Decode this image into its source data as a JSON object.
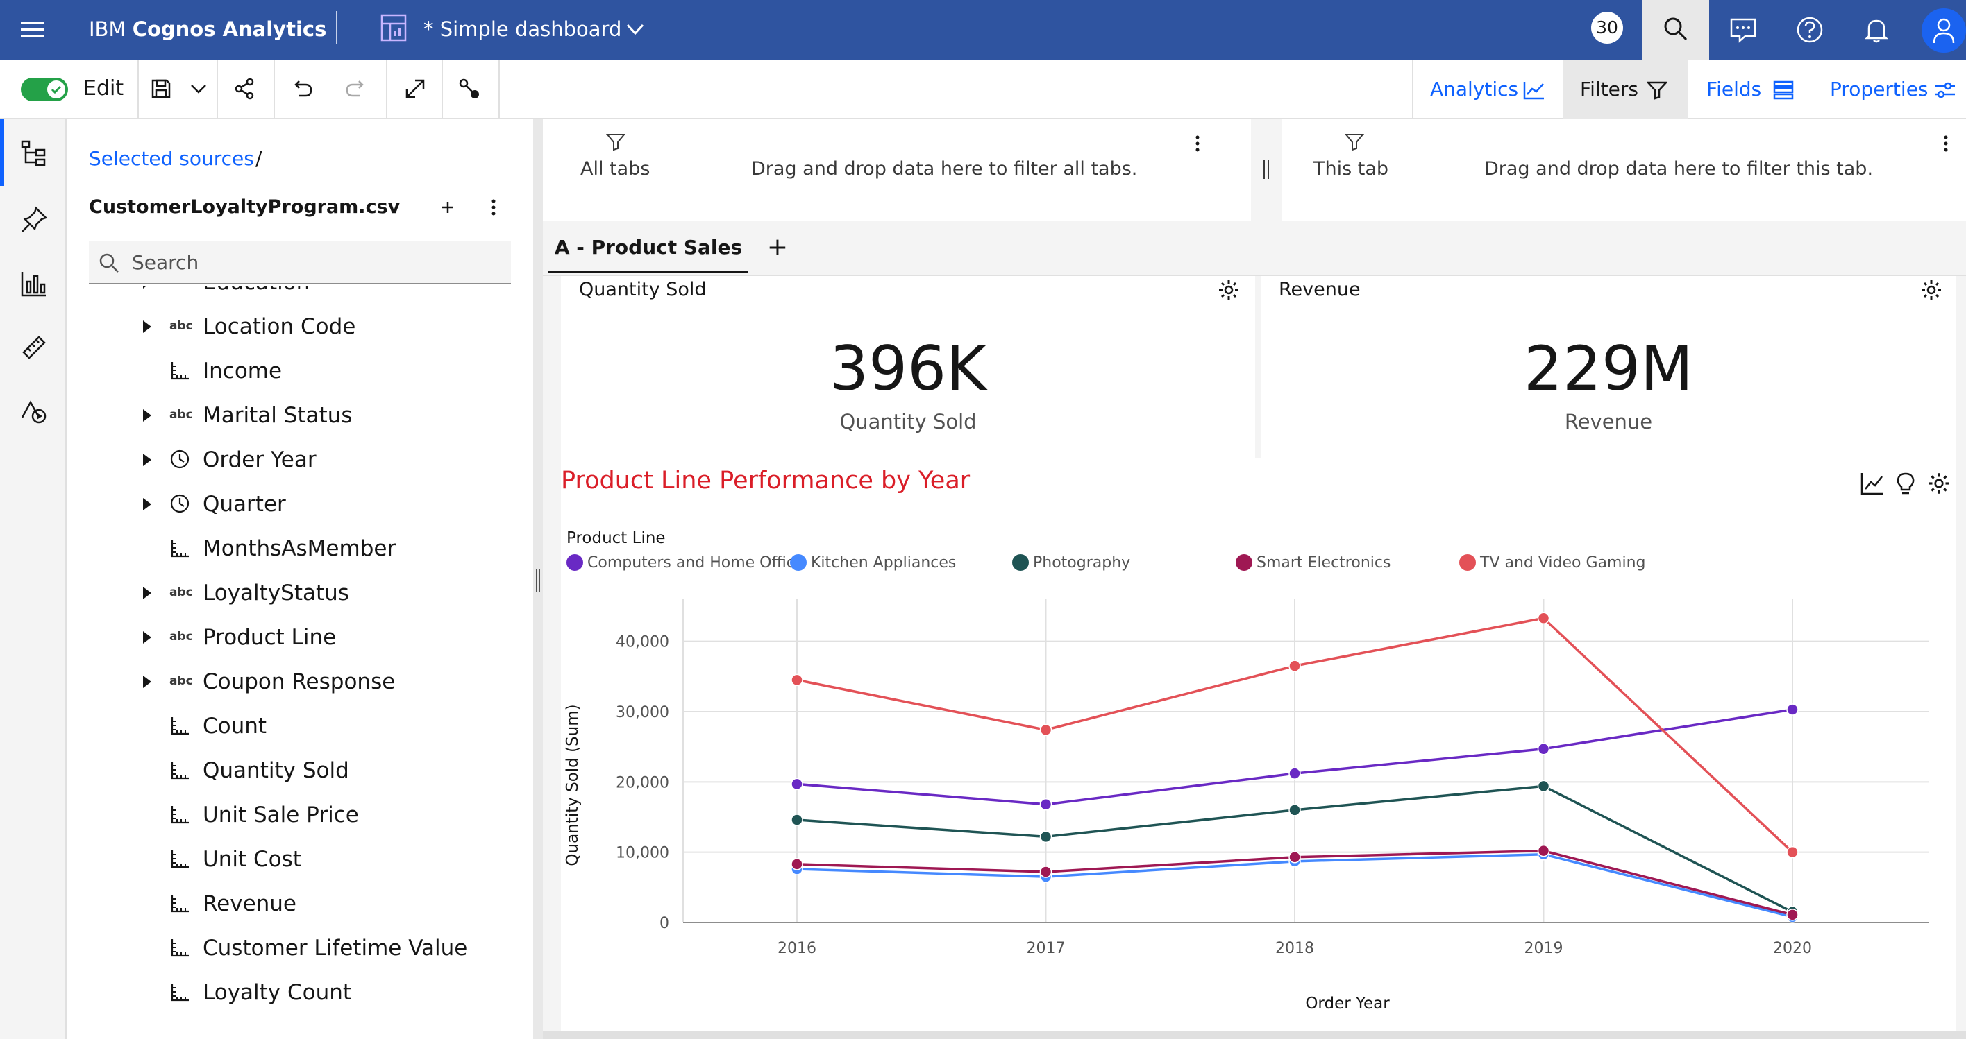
{
  "topbar": {
    "brand_prefix": "IBM ",
    "brand_name": "Cognos Analytics",
    "dashboard_title": "* Simple dashboard",
    "notification_count": "30"
  },
  "toolbar": {
    "edit_label": "Edit",
    "edit_mode_on": true,
    "tabs": [
      "Analytics",
      "Filters",
      "Fields",
      "Properties"
    ],
    "active_tab": "Filters"
  },
  "panel": {
    "breadcrumb": "Selected sources",
    "breadcrumb_sep": "/",
    "source_name": "CustomerLoyaltyProgram.csv",
    "search_placeholder": "Search",
    "fields": [
      {
        "name": "Education",
        "type": "abc",
        "expandable": true
      },
      {
        "name": "Location Code",
        "type": "abc",
        "expandable": true
      },
      {
        "name": "Income",
        "type": "measure",
        "expandable": false
      },
      {
        "name": "Marital Status",
        "type": "abc",
        "expandable": true
      },
      {
        "name": "Order Year",
        "type": "time",
        "expandable": true
      },
      {
        "name": "Quarter",
        "type": "time",
        "expandable": true
      },
      {
        "name": "MonthsAsMember",
        "type": "measure",
        "expandable": false
      },
      {
        "name": "LoyaltyStatus",
        "type": "abc",
        "expandable": true
      },
      {
        "name": "Product Line",
        "type": "abc",
        "expandable": true
      },
      {
        "name": "Coupon Response",
        "type": "abc",
        "expandable": true
      },
      {
        "name": "Count",
        "type": "measure",
        "expandable": false
      },
      {
        "name": "Quantity Sold",
        "type": "measure",
        "expandable": false
      },
      {
        "name": "Unit Sale Price",
        "type": "measure",
        "expandable": false
      },
      {
        "name": "Unit Cost",
        "type": "measure",
        "expandable": false
      },
      {
        "name": "Revenue",
        "type": "measure",
        "expandable": false
      },
      {
        "name": "Customer Lifetime Value",
        "type": "measure",
        "expandable": false
      },
      {
        "name": "Loyalty Count",
        "type": "measure",
        "expandable": false
      }
    ]
  },
  "filters": {
    "all_tabs_label": "All tabs",
    "all_tabs_hint": "Drag and drop data here to filter all tabs.",
    "this_tab_label": "This tab",
    "this_tab_hint": "Drag and drop data here to filter this tab."
  },
  "tabs": {
    "items": [
      "A - Product Sales"
    ],
    "add_label": "+"
  },
  "kpis": [
    {
      "title": "Quantity Sold",
      "value": "396K",
      "label": "Quantity Sold"
    },
    {
      "title": "Revenue",
      "value": "229M",
      "label": "Revenue"
    }
  ],
  "chart": {
    "title": "Product Line Performance by Year",
    "legend_title": "Product Line"
  },
  "colors": {
    "topbar": "#2f54a0",
    "accent": "#0f62fe",
    "chart_title": "#da1e28"
  },
  "chart_data": {
    "type": "line",
    "title": "Product Line Performance by Year",
    "xlabel": "Order Year",
    "ylabel": "Quantity Sold (Sum)",
    "x": [
      "2016",
      "2017",
      "2018",
      "2019",
      "2020"
    ],
    "ylim": [
      0,
      45000
    ],
    "yticks": [
      0,
      10000,
      20000,
      30000,
      40000
    ],
    "ytick_labels": [
      "0",
      "10,000",
      "20,000",
      "30,000",
      "40,000"
    ],
    "grid": true,
    "legend_title": "Product Line",
    "legend_position": "top-left",
    "series": [
      {
        "name": "Computers and Home Office",
        "color": "#6929c4",
        "values": [
          19700,
          16800,
          21200,
          24700,
          30300
        ]
      },
      {
        "name": "Kitchen Appliances",
        "color": "#4589ff",
        "values": [
          7600,
          6500,
          8700,
          9700,
          800
        ]
      },
      {
        "name": "Photography",
        "color": "#1f5454",
        "values": [
          14600,
          12200,
          16000,
          19400,
          1500
        ]
      },
      {
        "name": "Smart Electronics",
        "color": "#9f1853",
        "values": [
          8300,
          7200,
          9300,
          10200,
          1100
        ]
      },
      {
        "name": "TV and Video Gaming",
        "color": "#e35157",
        "values": [
          34500,
          27400,
          36500,
          43300,
          10000
        ]
      }
    ]
  }
}
